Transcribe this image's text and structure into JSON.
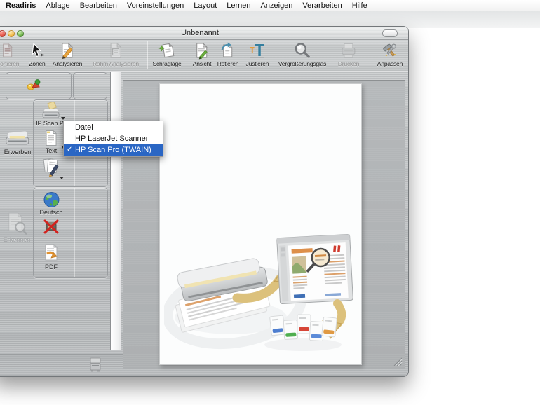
{
  "menu_bar": {
    "items": [
      "Readiris",
      "Ablage",
      "Bearbeiten",
      "Voreinstellungen",
      "Layout",
      "Lernen",
      "Anzeigen",
      "Verarbeiten",
      "Hilfe"
    ]
  },
  "window": {
    "title": "Unbenannt",
    "toolbar": [
      {
        "label": "Sortieren",
        "icon": "sort-pages-icon",
        "enabled": false
      },
      {
        "label": "Zonen",
        "icon": "zones-cursor-icon",
        "enabled": true
      },
      {
        "label": "Analysieren",
        "icon": "analyze-page-icon",
        "enabled": true
      },
      {
        "label": "Rahm Analysieren",
        "icon": "analyze-frame-icon",
        "enabled": false
      },
      {
        "label": "Schräglage",
        "icon": "deskew-icon",
        "enabled": true
      },
      {
        "label": "Ansicht",
        "icon": "view-page-icon",
        "enabled": true
      },
      {
        "label": "Rotieren",
        "icon": "rotate-page-icon",
        "enabled": true
      },
      {
        "label": "Justieren",
        "icon": "align-text-icon",
        "enabled": true
      },
      {
        "label": "Vergrößerungsglas",
        "icon": "magnifier-icon",
        "enabled": true
      },
      {
        "label": "Drucken",
        "icon": "printer-icon",
        "enabled": false
      },
      {
        "label": "Anpassen",
        "icon": "customize-icon",
        "enabled": true
      }
    ],
    "sidebar": {
      "acquire_label": "Erwerben",
      "recognize_label": "Erkennen",
      "scanner_label": "HP Scan Pro",
      "format_label": "Text",
      "language_label": "Deutsch",
      "output_label": "PDF"
    },
    "popup_menu": {
      "check_glyph": "✓",
      "items": [
        {
          "label": "Datei",
          "checked": false,
          "selected": false
        },
        {
          "label": "HP LaserJet Scanner",
          "checked": false,
          "selected": false
        },
        {
          "label": "HP Scan Pro (TWAIN)",
          "checked": true,
          "selected": true
        }
      ]
    }
  },
  "colors": {
    "selection_blue": "#2a66c4",
    "metal_gray": "#c2c5c7",
    "viewport_gray": "#b2b5b7",
    "arrow_tan": "#dcc17c"
  }
}
